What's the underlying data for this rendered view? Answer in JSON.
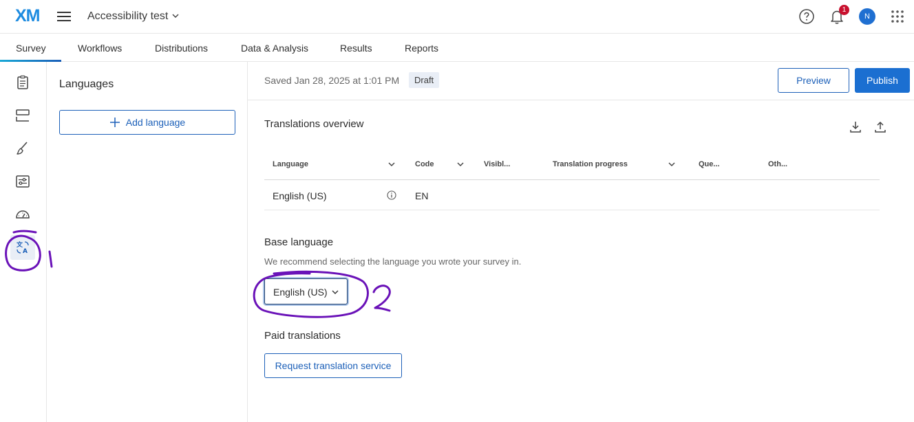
{
  "app": {
    "logo_text": "XM",
    "project_title": "Accessibility test",
    "notification_count": "1",
    "avatar_initial": "N"
  },
  "tabs": [
    {
      "label": "Survey",
      "active": true
    },
    {
      "label": "Workflows"
    },
    {
      "label": "Distributions"
    },
    {
      "label": "Data & Analysis"
    },
    {
      "label": "Results"
    },
    {
      "label": "Reports"
    }
  ],
  "rail_icons": [
    "survey-clipboard-icon",
    "blocks-icon",
    "paintbrush-icon",
    "options-sliders-icon",
    "gauge-icon",
    "translate-icon"
  ],
  "languages_panel": {
    "title": "Languages",
    "add_button": "Add language"
  },
  "header": {
    "saved_text": "Saved Jan 28, 2025 at 1:01 PM",
    "status_badge": "Draft",
    "preview_label": "Preview",
    "publish_label": "Publish"
  },
  "overview": {
    "title": "Translations overview",
    "columns": [
      "Language",
      "Code",
      "Visibl...",
      "Translation progress",
      "Que...",
      "Oth..."
    ],
    "rows": [
      {
        "language": "English (US)",
        "code": "EN"
      }
    ]
  },
  "base_language": {
    "title": "Base language",
    "description": "We recommend selecting the language you wrote your survey in.",
    "selected": "English (US)"
  },
  "paid_translations": {
    "title": "Paid translations",
    "button": "Request translation service"
  },
  "colors": {
    "accent": "#1b5fb8",
    "primary_button": "#1b6fd1",
    "annotation": "#6a12b8",
    "badge": "#c8102e"
  }
}
